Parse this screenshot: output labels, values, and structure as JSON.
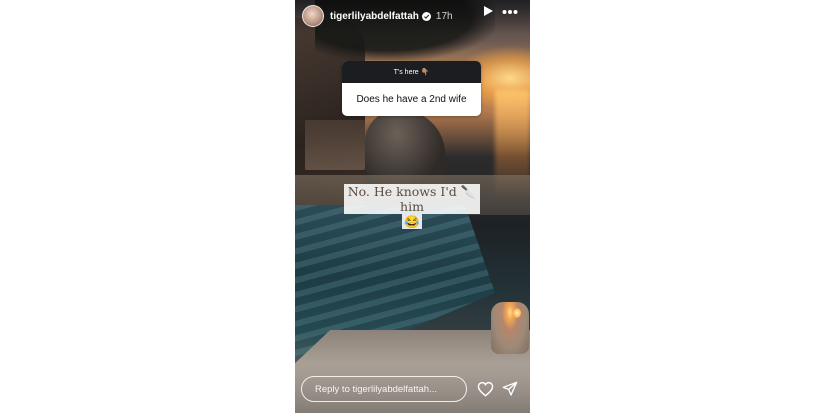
{
  "story": {
    "header": {
      "username": "tigerlilyabdelfattah",
      "time": "17h",
      "icons": [
        "avatar",
        "verified-badge-icon",
        "play-icon",
        "more-icon"
      ]
    },
    "question_sticker": {
      "header_text": "T's here 👇🏽",
      "question": "Does he have a 2nd wife"
    },
    "answer": {
      "line1": "No. He knows I'd 🔪 him",
      "line2": "😂"
    },
    "reply_bar": {
      "placeholder": "Reply to tigerlilyabdelfattah..."
    },
    "actions": [
      "heart-icon",
      "send-icon"
    ]
  },
  "colors": {
    "page_bg": "#ffffff",
    "sticker_header": "#1c1d21",
    "answer_text": "#5b4a3e"
  }
}
